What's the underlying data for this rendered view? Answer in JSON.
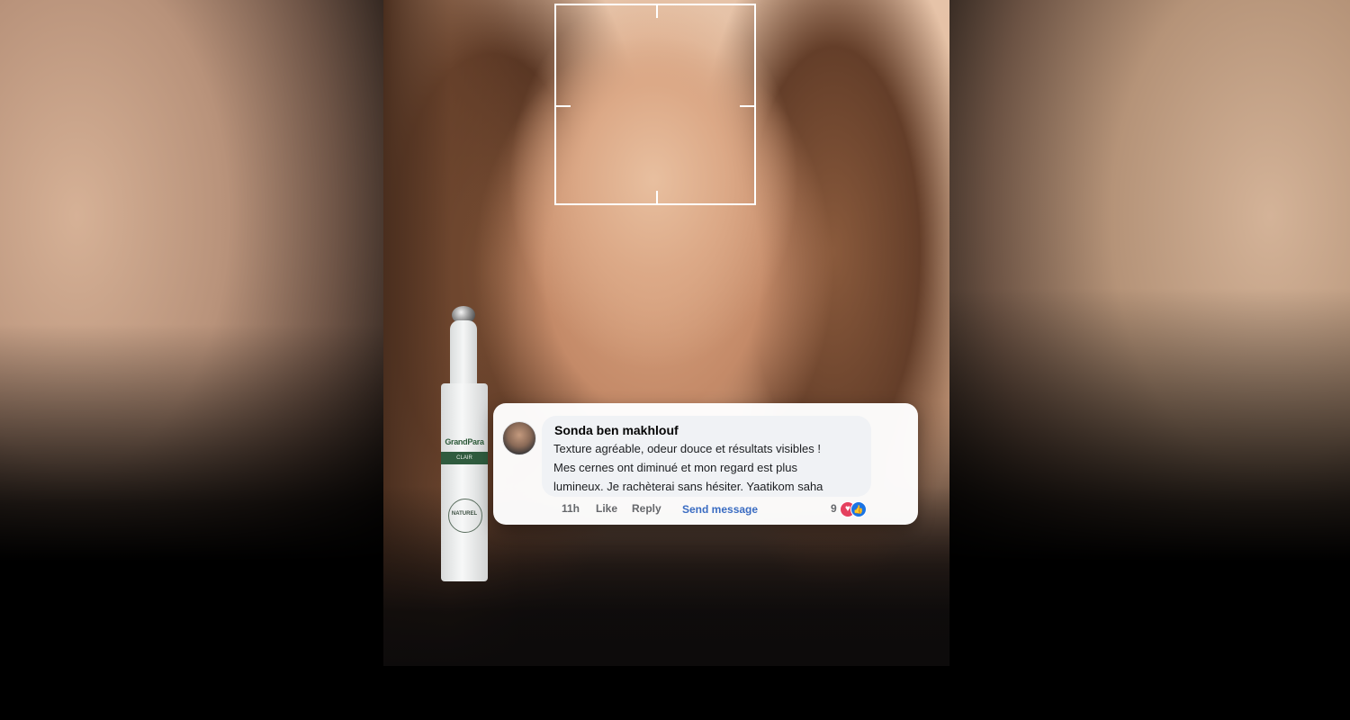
{
  "comment": {
    "author": "Sonda ben makhlouf",
    "text_lines": [
      "Texture agréable, odeur douce et résultats visibles !",
      "Mes cernes ont diminué et mon regard est plus",
      "lumineux. Je rachèterai sans hésiter. Yaatikom saha"
    ],
    "time": "11h",
    "like_label": "Like",
    "reply_label": "Reply",
    "send_message_label": "Send message",
    "reaction_count": "9",
    "reaction_icons": [
      "heart-icon",
      "like-icon"
    ]
  },
  "product": {
    "brand": "GrandPara",
    "band_text": "CLAIR",
    "seal_text": "NATUREL"
  },
  "colors": {
    "link_blue": "#3a6cc2",
    "heart_red": "#e5405e",
    "like_blue": "#1b74e4",
    "brand_green": "#2f5b3e"
  }
}
